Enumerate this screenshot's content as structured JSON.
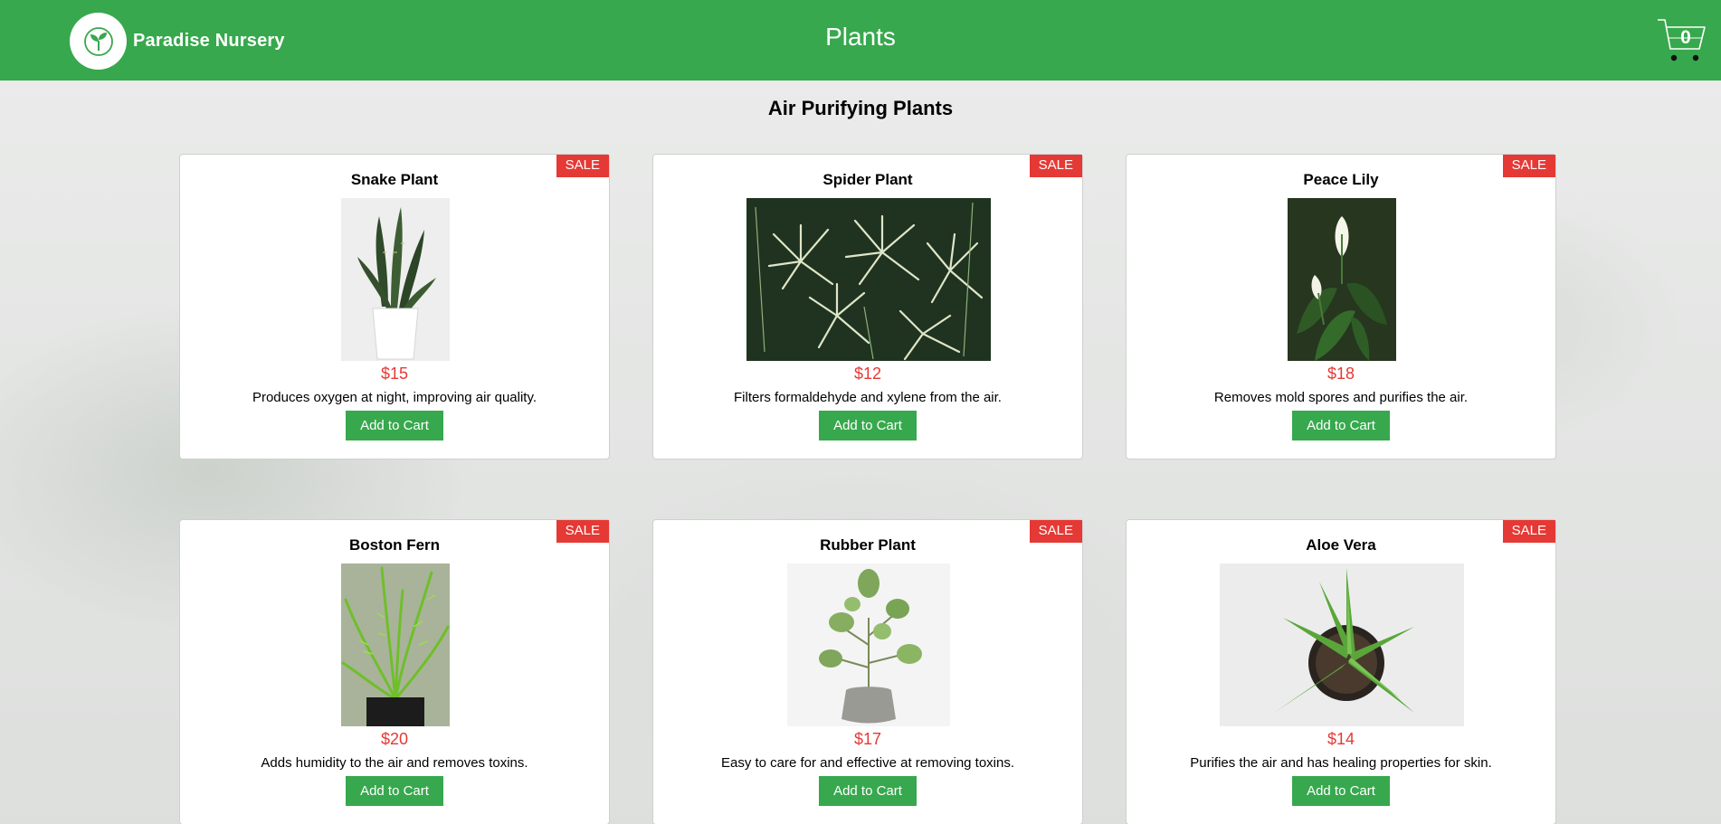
{
  "header": {
    "brand_name": "Paradise Nursery",
    "title": "Plants",
    "cart_count": "0",
    "brand_color": "#37a84d"
  },
  "section": {
    "heading": "Air Purifying Plants"
  },
  "colors": {
    "sale_badge": "#e53935",
    "price": "#e53935",
    "button": "#37a84d"
  },
  "plants": [
    {
      "name": "Snake Plant",
      "badge": "SALE",
      "price": "$15",
      "description": "Produces oxygen at night, improving air quality.",
      "button_label": "Add to Cart",
      "image": "snake-plant-photo"
    },
    {
      "name": "Spider Plant",
      "badge": "SALE",
      "price": "$12",
      "description": "Filters formaldehyde and xylene from the air.",
      "button_label": "Add to Cart",
      "image": "spider-plant-photo"
    },
    {
      "name": "Peace Lily",
      "badge": "SALE",
      "price": "$18",
      "description": "Removes mold spores and purifies the air.",
      "button_label": "Add to Cart",
      "image": "peace-lily-photo"
    },
    {
      "name": "Boston Fern",
      "badge": "SALE",
      "price": "$20",
      "description": "Adds humidity to the air and removes toxins.",
      "button_label": "Add to Cart",
      "image": "boston-fern-photo"
    },
    {
      "name": "Rubber Plant",
      "badge": "SALE",
      "price": "$17",
      "description": "Easy to care for and effective at removing toxins.",
      "button_label": "Add to Cart",
      "image": "rubber-plant-photo"
    },
    {
      "name": "Aloe Vera",
      "badge": "SALE",
      "price": "$14",
      "description": "Purifies the air and has healing properties for skin.",
      "button_label": "Add to Cart",
      "image": "aloe-vera-photo"
    }
  ]
}
